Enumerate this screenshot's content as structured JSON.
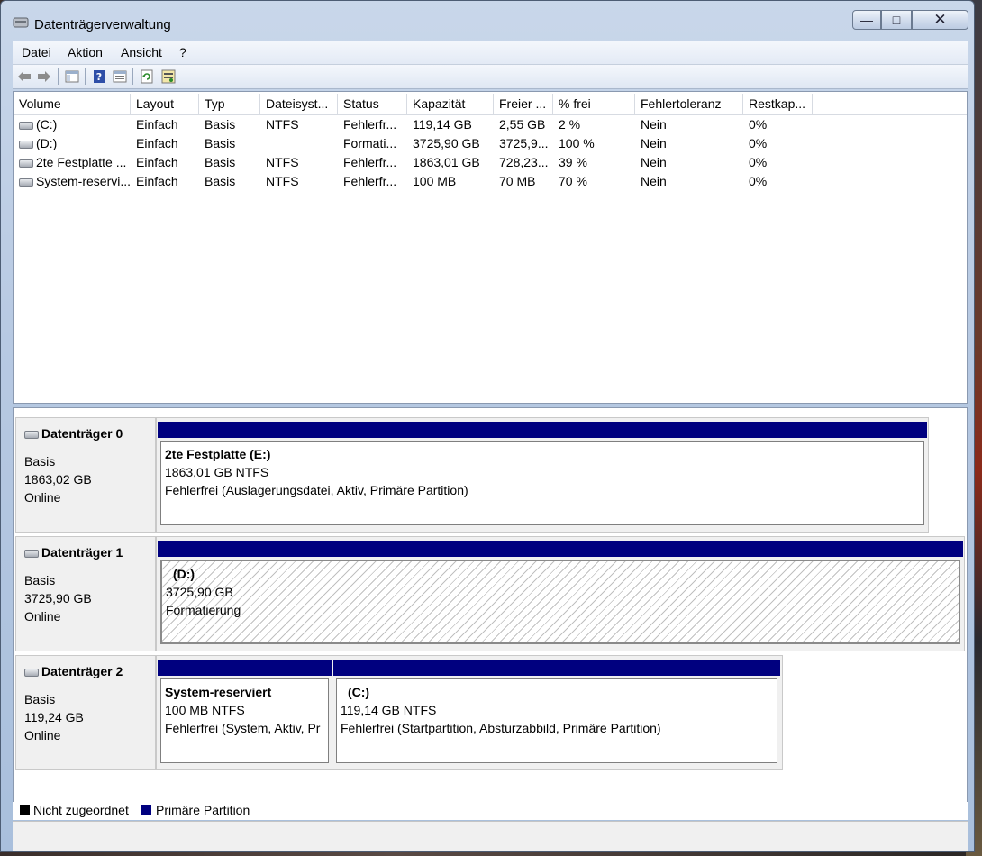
{
  "window": {
    "title": "Datenträgerverwaltung",
    "min_glyph": "—",
    "max_glyph": "□",
    "close_glyph": "✕"
  },
  "menu": [
    "Datei",
    "Aktion",
    "Ansicht",
    "?"
  ],
  "toolbar": {
    "icons": [
      "back-arrow-icon",
      "forward-arrow-icon",
      "console-tree-icon",
      "help-icon",
      "properties-icon",
      "refresh-icon",
      "rescan-disks-icon"
    ]
  },
  "volumes": {
    "columns": [
      "Volume",
      "Layout",
      "Typ",
      "Dateisyst...",
      "Status",
      "Kapazität",
      "Freier ...",
      "% frei",
      "Fehlertoleranz",
      "Restkap..."
    ],
    "rows": [
      [
        "(C:)",
        "Einfach",
        "Basis",
        "NTFS",
        "Fehlerfr...",
        "119,14 GB",
        "2,55 GB",
        "2 %",
        "Nein",
        "0%"
      ],
      [
        "(D:)",
        "Einfach",
        "Basis",
        "",
        "Formati...",
        "3725,90 GB",
        "3725,9...",
        "100 %",
        "Nein",
        "0%"
      ],
      [
        "2te Festplatte ...",
        "Einfach",
        "Basis",
        "NTFS",
        "Fehlerfr...",
        "1863,01 GB",
        "728,23...",
        "39 %",
        "Nein",
        "0%"
      ],
      [
        "System-reservi...",
        "Einfach",
        "Basis",
        "NTFS",
        "Fehlerfr...",
        "100 MB",
        "70 MB",
        "70 %",
        "Nein",
        "0%"
      ]
    ]
  },
  "disks": [
    {
      "name": "Datenträger 0",
      "type": "Basis",
      "size": "1863,02 GB",
      "state": "Online",
      "partitions": [
        {
          "name": "2te Festplatte  (E:)",
          "size": "1863,01 GB NTFS",
          "status": "Fehlerfrei (Auslagerungsdatei, Aktiv, Primäre Partition)"
        }
      ]
    },
    {
      "name": "Datenträger 1",
      "type": "Basis",
      "size": "3725,90 GB",
      "state": "Online",
      "partitions": [
        {
          "name": "(D:)",
          "size": "3725,90 GB",
          "status": "Formatierung"
        }
      ]
    },
    {
      "name": "Datenträger 2",
      "type": "Basis",
      "size": "119,24 GB",
      "state": "Online",
      "partitions": [
        {
          "name": "System-reserviert",
          "size": "100 MB NTFS",
          "status": "Fehlerfrei (System, Aktiv, Pr"
        },
        {
          "name": "(C:)",
          "size": "119,14 GB NTFS",
          "status": "Fehlerfrei (Startpartition, Absturzabbild, Primäre Partition)"
        }
      ]
    }
  ],
  "legend": [
    {
      "label": "Nicht zugeordnet",
      "color": "#000000"
    },
    {
      "label": "Primäre Partition",
      "color": "#00007f"
    }
  ]
}
